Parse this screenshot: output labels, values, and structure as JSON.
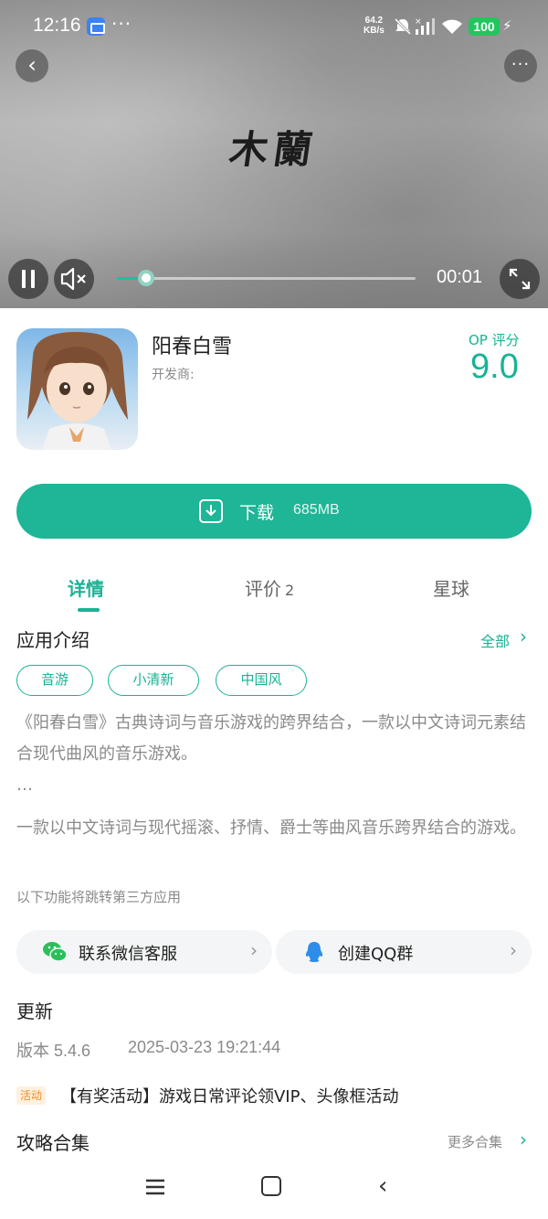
{
  "status_bar": {
    "time": "12:16",
    "dots": "···",
    "net_speed_value": "64.2",
    "net_speed_unit": "KB/s",
    "battery": "100"
  },
  "video": {
    "title": "木蘭",
    "current_time": "00:01",
    "progress": 0.1
  },
  "app": {
    "name": "阳春白雪",
    "developer_label": "开发商:",
    "score_label": "OP 评分",
    "score": "9.0"
  },
  "download": {
    "label": "下载",
    "size": "685MB"
  },
  "tabs": {
    "details": "详情",
    "reviews": "评价",
    "reviews_count": "2",
    "planet": "星球"
  },
  "intro": {
    "title": "应用介绍",
    "all_link": "全部",
    "tags": [
      "音游",
      "小清新",
      "中国风"
    ],
    "description_1": "《阳春白雪》古典诗词与音乐游戏的跨界结合，一款以中文诗词元素结合现代曲风的音乐游戏。",
    "ellipsis": "…",
    "description_2": "一款以中文诗词与现代摇滚、抒情、爵士等曲风音乐跨界结合的游戏。",
    "third_party_note": "以下功能将跳转第三方应用"
  },
  "services": {
    "wechat": "联系微信客服",
    "qq": "创建QQ群"
  },
  "update": {
    "title": "更新",
    "version": "版本 5.4.6",
    "date": "2025-03-23 19:21:44"
  },
  "activity": {
    "badge": "活动",
    "text": "【有奖活动】游戏日常评论领VIP、头像框活动"
  },
  "guides": {
    "title": "攻略合集",
    "more": "更多合集"
  },
  "colors": {
    "accent": "#19b394",
    "button": "#1fb597",
    "activity": "#f08a24"
  }
}
